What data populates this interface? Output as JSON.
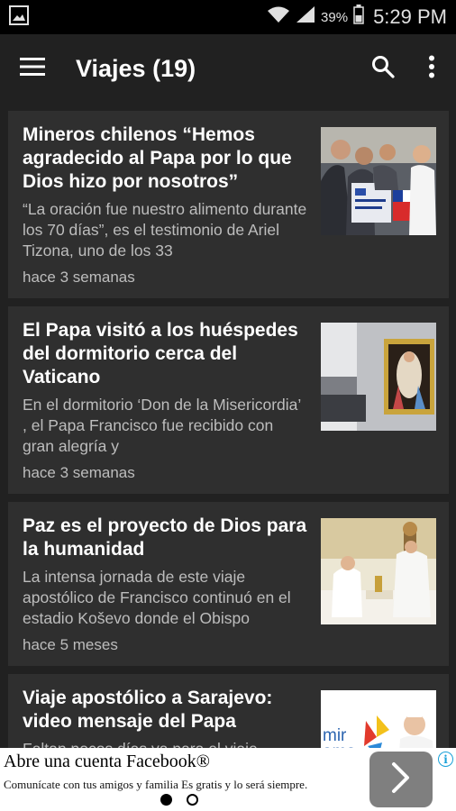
{
  "status_bar": {
    "battery_percent": "39%",
    "time": "5:29 PM"
  },
  "app_bar": {
    "title": "Viajes (19)"
  },
  "articles": [
    {
      "title": "Mineros chilenos “Hemos agradecido al Papa por lo que Dios hizo por nosotros”",
      "summary": "“La oración fue nuestro alimento durante los 70 días”, es el testimonio de Ariel Tizona, uno de los 33",
      "time": "hace 3 semanas"
    },
    {
      "title": "El Papa visitó a los huéspedes del dormitorio cerca del Vaticano",
      "summary": "En el dormitorio ‘Don de la Misericordia’ , el Papa Francisco fue recibido con gran alegría y",
      "time": "hace 3 semanas"
    },
    {
      "title": "Paz es el proyecto de Dios para la humanidad",
      "summary": "La intensa jornada de este viaje apostólico de Francisco continuó en el estadio Koševo donde el Obispo",
      "time": "hace 5 meses"
    },
    {
      "title": "Viaje apostólico a Sarajevo: video mensaje del Papa",
      "summary": "Faltan pocos días ya para el viaje",
      "time": ""
    }
  ],
  "ad": {
    "title": "Abre una cuenta Facebook®",
    "subtitle": "Comunícate con tus amigos y familia Es gratis y lo será siempre.",
    "logo_text": "mir ama"
  },
  "colors": {
    "background": "#212121",
    "card": "#2f2f2f",
    "ad_background": "#ffffff"
  }
}
